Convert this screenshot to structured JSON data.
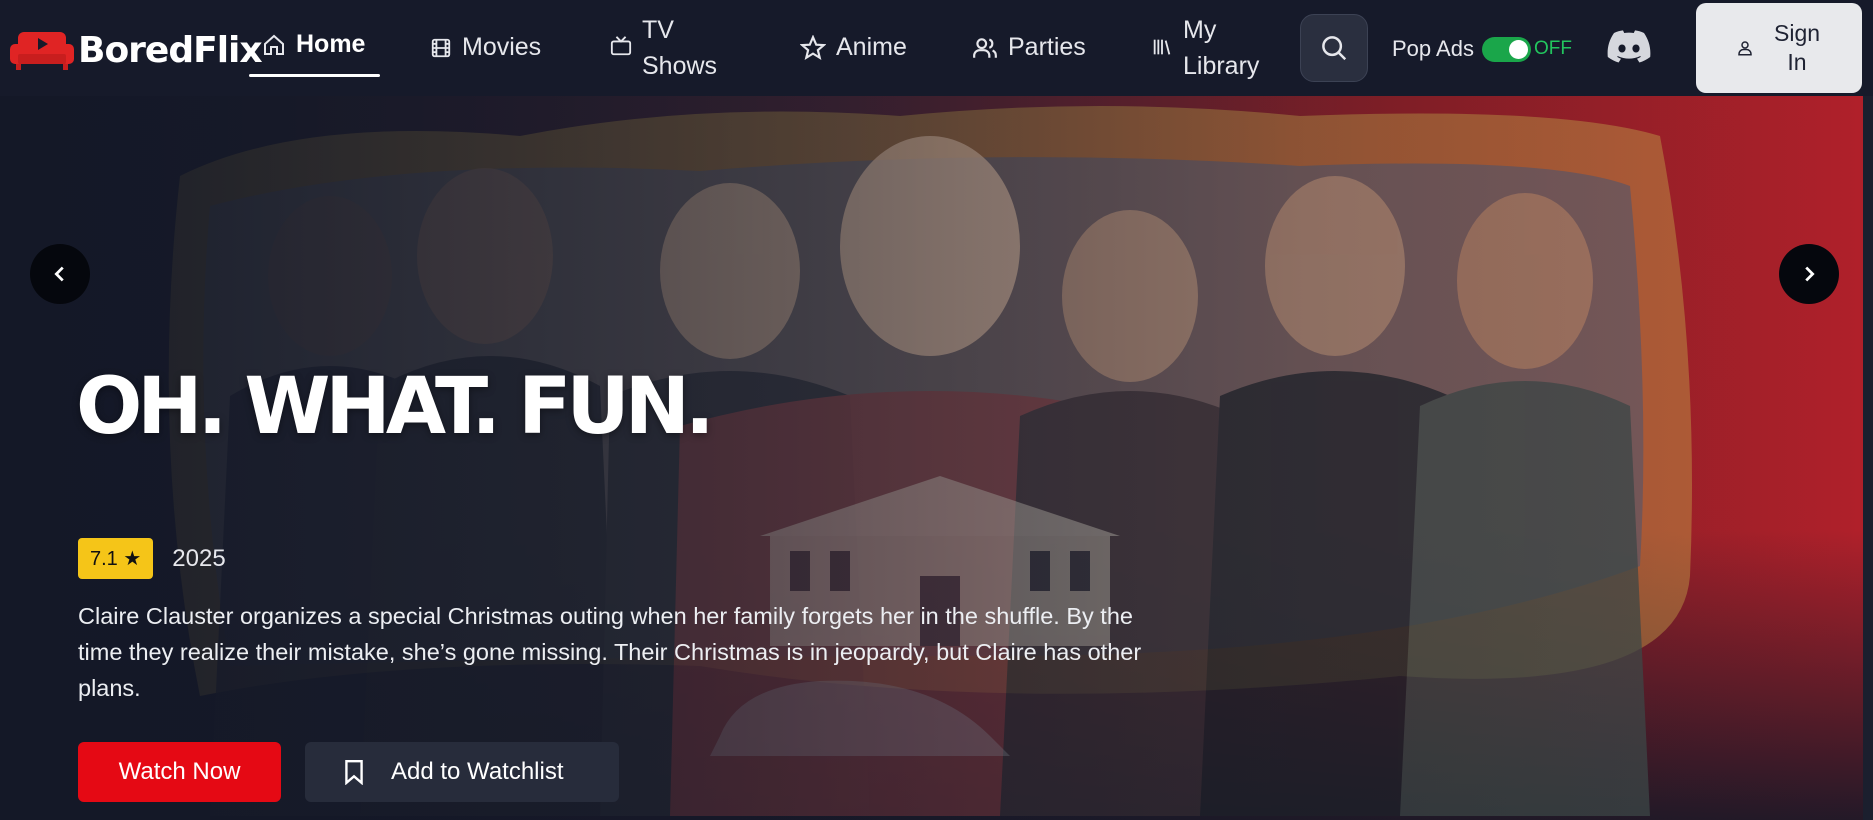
{
  "app": {
    "name": "BoredFlix"
  },
  "nav": {
    "home": "Home",
    "movies": "Movies",
    "tv_line1": "TV",
    "tv_line2": "Shows",
    "anime": "Anime",
    "parties": "Parties",
    "library_line1": "My",
    "library_line2": "Library",
    "popads_label": "Pop Ads",
    "popads_state": "OFF",
    "signin_line1": "Sign",
    "signin_line2": "In"
  },
  "icons": {
    "logo": "couch-icon",
    "home": "home-icon",
    "movies": "film-icon",
    "tv": "tv-icon",
    "anime": "star-icon",
    "parties": "users-icon",
    "library": "library-icon",
    "search": "search-icon",
    "discord": "discord-icon",
    "user": "user-icon",
    "prev": "chevron-left-icon",
    "next": "chevron-right-icon",
    "bookmark": "bookmark-icon"
  },
  "colors": {
    "accent": "#e50914",
    "rating_bg": "#f5c518",
    "toggle_on": "#1aa64a",
    "bg": "#141827"
  },
  "hero": {
    "title": "OH. WHAT. FUN.",
    "rating": "7.1 ★",
    "year": "2025",
    "description": "Claire Clauster organizes a special Christmas outing when her family forgets her in the shuffle. By the time they realize their mistake, she’s gone missing. Their Christmas is in jeopardy, but Claire has other plans.",
    "watch_label": "Watch Now",
    "watchlist_label": "Add to Watchlist"
  }
}
